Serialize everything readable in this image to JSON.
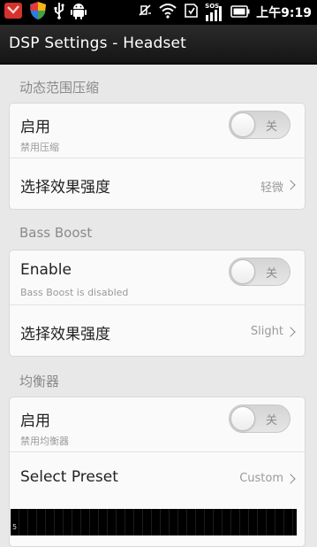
{
  "statusbar": {
    "time": "上午9:19",
    "icons": [
      "app-red-icon",
      "shield-icon",
      "usb-icon",
      "android-icon",
      "mute-icon",
      "wifi-icon",
      "sd-icon",
      "signal-sos-icon",
      "battery-icon"
    ],
    "sos": "SOS"
  },
  "titlebar": {
    "title": "DSP Settings - Headset"
  },
  "sections": {
    "drc": {
      "title": "动态范围压缩",
      "enable_label": "启用",
      "enable_sub": "禁用压缩",
      "toggle_text": "关",
      "strength_label": "选择效果强度",
      "strength_value": "轻微"
    },
    "bass": {
      "title": "Bass Boost",
      "enable_label": "Enable",
      "enable_sub": "Bass Boost is disabled",
      "toggle_text": "关",
      "strength_label": "选择效果强度",
      "strength_value": "Slight"
    },
    "eq": {
      "title": "均衡器",
      "enable_label": "启用",
      "enable_sub": "禁用均衡器",
      "toggle_text": "关",
      "preset_label": "Select Preset",
      "preset_value": "Custom",
      "graph_label": "5"
    }
  },
  "colors": {
    "background": "#e8e8e8",
    "titlebar": "#1e1e1e",
    "card": "#fafafa"
  }
}
